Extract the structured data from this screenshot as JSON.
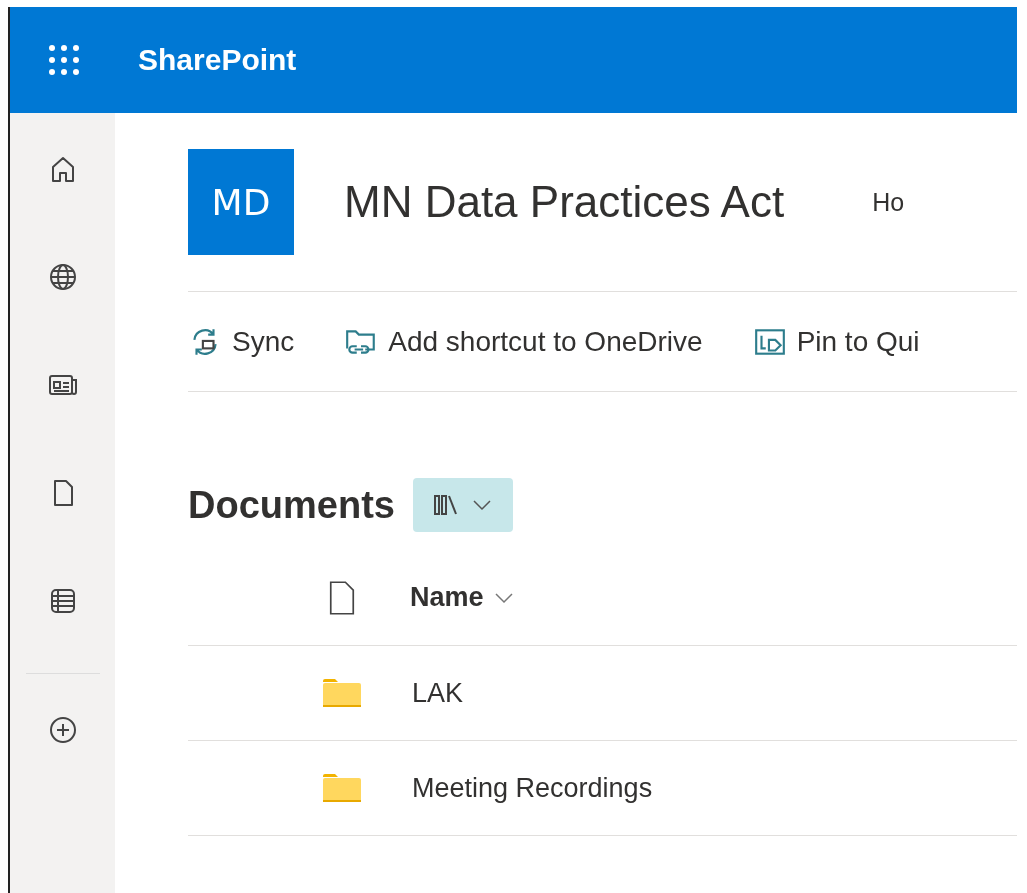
{
  "app_bar": {
    "title": "SharePoint"
  },
  "sidebar": {
    "items": [
      {
        "kind": "home"
      },
      {
        "kind": "globe"
      },
      {
        "kind": "news"
      },
      {
        "kind": "file"
      },
      {
        "kind": "list"
      },
      {
        "kind": "divider"
      },
      {
        "kind": "add"
      }
    ]
  },
  "site": {
    "logo": "MD",
    "title": "MN Data Practices Act",
    "nav": [
      "Ho"
    ]
  },
  "command_bar": [
    {
      "kind": "sync",
      "label": "Sync"
    },
    {
      "kind": "shortcut",
      "label": "Add shortcut to OneDrive"
    },
    {
      "kind": "pin",
      "label": "Pin to Qui"
    }
  ],
  "library": {
    "title": "Documents",
    "columns": [
      {
        "label": "Name"
      }
    ],
    "rows": [
      {
        "kind": "folder",
        "name": "LAK"
      },
      {
        "kind": "folder",
        "name": "Meeting Recordings"
      }
    ]
  }
}
